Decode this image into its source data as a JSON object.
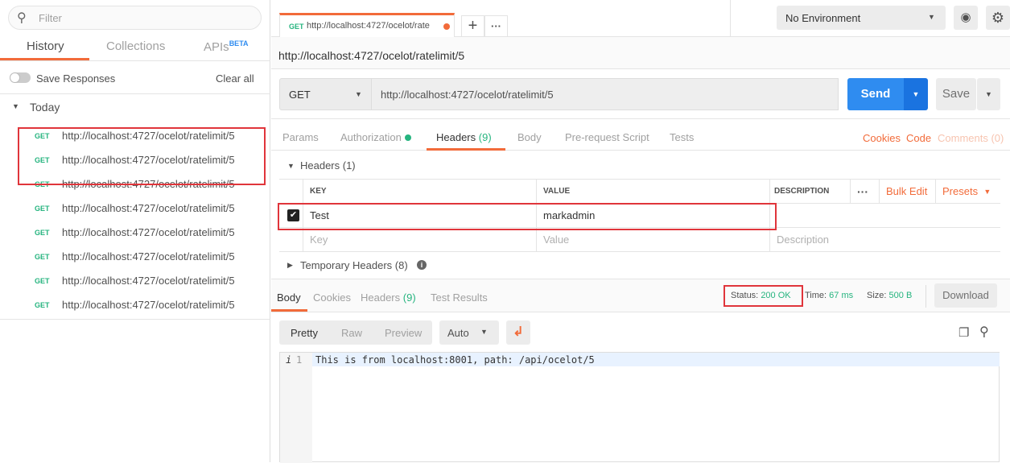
{
  "sidebar": {
    "filter_placeholder": "Filter",
    "tabs": [
      {
        "label": "History"
      },
      {
        "label": "Collections"
      },
      {
        "label": "APIs",
        "badge": "BETA"
      }
    ],
    "save_responses": "Save Responses",
    "clear_all": "Clear all",
    "group": "Today",
    "items": [
      {
        "method": "GET",
        "url": "http://localhost:4727/ocelot/ratelimit/5"
      },
      {
        "method": "GET",
        "url": "http://localhost:4727/ocelot/ratelimit/5"
      },
      {
        "method": "GET",
        "url": "http://localhost:4727/ocelot/ratelimit/5"
      },
      {
        "method": "GET",
        "url": "http://localhost:4727/ocelot/ratelimit/5"
      },
      {
        "method": "GET",
        "url": "http://localhost:4727/ocelot/ratelimit/5"
      },
      {
        "method": "GET",
        "url": "http://localhost:4727/ocelot/ratelimit/5"
      },
      {
        "method": "GET",
        "url": "http://localhost:4727/ocelot/ratelimit/5"
      },
      {
        "method": "GET",
        "url": "http://localhost:4727/ocelot/ratelimit/5"
      }
    ]
  },
  "tab": {
    "method": "GET",
    "title": "http://localhost:4727/ocelot/rate"
  },
  "environment": "No Environment",
  "request": {
    "title": "http://localhost:4727/ocelot/ratelimit/5",
    "method": "GET",
    "url": "http://localhost:4727/ocelot/ratelimit/5",
    "send": "Send",
    "save": "Save",
    "tabs": {
      "params": "Params",
      "authorization": "Authorization",
      "headers": "Headers",
      "headers_count": "(9)",
      "body": "Body",
      "prerequest": "Pre-request Script",
      "tests": "Tests"
    },
    "links": {
      "cookies": "Cookies",
      "code": "Code",
      "comments": "Comments (0)"
    },
    "headers_section": "Headers (1)",
    "columns": {
      "key": "KEY",
      "value": "VALUE",
      "description": "DESCRIPTION",
      "bulk_edit": "Bulk Edit",
      "presets": "Presets"
    },
    "headers": [
      {
        "checked": true,
        "key": "Test",
        "value": "markadmin",
        "description": ""
      }
    ],
    "placeholders": {
      "key": "Key",
      "value": "Value",
      "description": "Description"
    },
    "temporary_headers": "Temporary Headers (8)"
  },
  "response": {
    "tabs": {
      "body": "Body",
      "cookies": "Cookies",
      "headers": "Headers",
      "headers_count": "(9)",
      "test_results": "Test Results"
    },
    "status_label": "Status:",
    "status": "200 OK",
    "time_label": "Time:",
    "time": "67 ms",
    "size_label": "Size:",
    "size": "500 B",
    "download": "Download",
    "views": {
      "pretty": "Pretty",
      "raw": "Raw",
      "preview": "Preview"
    },
    "format": "Auto",
    "line_number": "1",
    "body": "This is from localhost:8001, path: /api/ocelot/5"
  },
  "colors": {
    "accent": "#f26b3a",
    "send": "#2f8cf0",
    "status": "#26b47f",
    "highlight": "#e0353b"
  }
}
